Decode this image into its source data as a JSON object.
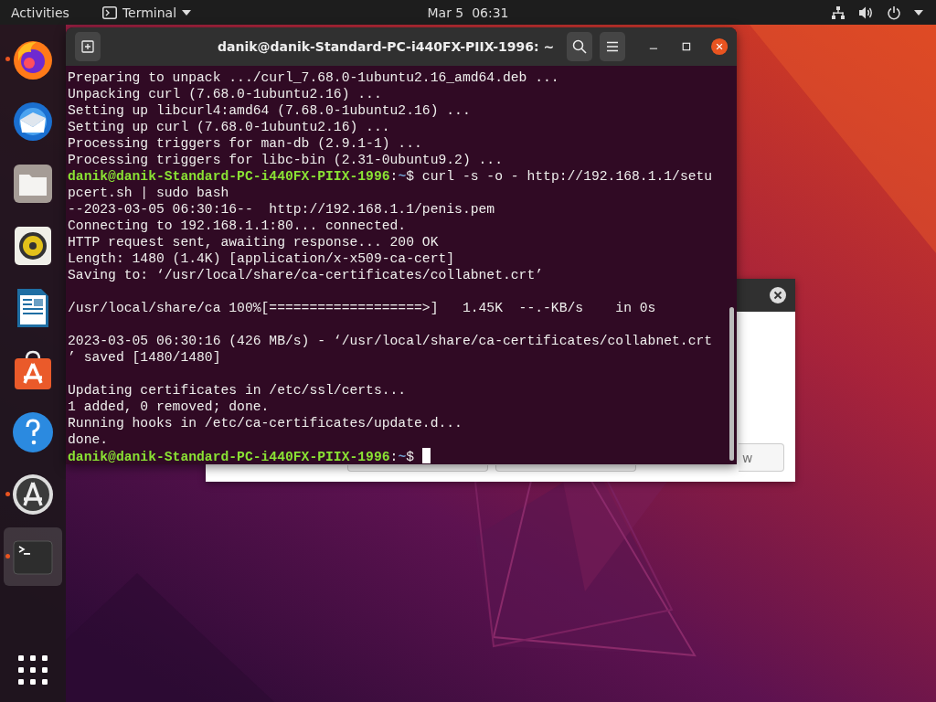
{
  "top_bar": {
    "activities": "Activities",
    "app_menu": "Terminal",
    "clock": "Mar 5  06:31"
  },
  "dock": {
    "items": [
      {
        "running": true,
        "selected": false
      },
      {
        "running": false,
        "selected": false
      },
      {
        "running": false,
        "selected": false
      },
      {
        "running": false,
        "selected": false
      },
      {
        "running": false,
        "selected": false
      },
      {
        "running": false,
        "selected": false
      },
      {
        "running": false,
        "selected": false
      },
      {
        "running": true,
        "selected": false
      },
      {
        "running": true,
        "selected": true
      }
    ]
  },
  "background_dialog": {
    "last_button_label": "w"
  },
  "terminal": {
    "title": "danik@danik-Standard-PC-i440FX-PIIX-1996: ~",
    "lines": [
      {
        "kind": "output",
        "text": "Preparing to unpack .../curl_7.68.0-1ubuntu2.16_amd64.deb ..."
      },
      {
        "kind": "output",
        "text": "Unpacking curl (7.68.0-1ubuntu2.16) ..."
      },
      {
        "kind": "output",
        "text": "Setting up libcurl4:amd64 (7.68.0-1ubuntu2.16) ..."
      },
      {
        "kind": "output",
        "text": "Setting up curl (7.68.0-1ubuntu2.16) ..."
      },
      {
        "kind": "output",
        "text": "Processing triggers for man-db (2.9.1-1) ..."
      },
      {
        "kind": "output",
        "text": "Processing triggers for libc-bin (2.31-0ubuntu9.2) ..."
      },
      {
        "kind": "prompt",
        "user_host": "danik@danik-Standard-PC-i440FX-PIIX-1996",
        "separator": ":",
        "path": "~",
        "symbol": "$",
        "command": "curl -s -o - http://192.168.1.1/setu",
        "cursor": false
      },
      {
        "kind": "output",
        "text": "pcert.sh | sudo bash"
      },
      {
        "kind": "output",
        "text": "--2023-03-05 06:30:16--  http://192.168.1.1/penis.pem"
      },
      {
        "kind": "output",
        "text": "Connecting to 192.168.1.1:80... connected."
      },
      {
        "kind": "output",
        "text": "HTTP request sent, awaiting response... 200 OK"
      },
      {
        "kind": "output",
        "text": "Length: 1480 (1.4K) [application/x-x509-ca-cert]"
      },
      {
        "kind": "output",
        "text": "Saving to: ‘/usr/local/share/ca-certificates/collabnet.crt’"
      },
      {
        "kind": "blank"
      },
      {
        "kind": "output",
        "text": "/usr/local/share/ca 100%[===================>]   1.45K  --.-KB/s    in 0s"
      },
      {
        "kind": "blank"
      },
      {
        "kind": "output",
        "text": "2023-03-05 06:30:16 (426 MB/s) - ‘/usr/local/share/ca-certificates/collabnet.crt"
      },
      {
        "kind": "output",
        "text": "’ saved [1480/1480]"
      },
      {
        "kind": "blank"
      },
      {
        "kind": "output",
        "text": "Updating certificates in /etc/ssl/certs..."
      },
      {
        "kind": "output",
        "text": "1 added, 0 removed; done."
      },
      {
        "kind": "output",
        "text": "Running hooks in /etc/ca-certificates/update.d..."
      },
      {
        "kind": "output",
        "text": "done."
      },
      {
        "kind": "prompt",
        "user_host": "danik@danik-Standard-PC-i440FX-PIIX-1996",
        "separator": ":",
        "path": "~",
        "symbol": "$",
        "cursor": true
      }
    ]
  }
}
